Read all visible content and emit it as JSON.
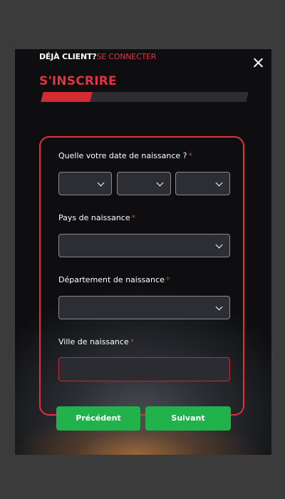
{
  "header": {
    "login_question": "DÉJÀ CLIENT?",
    "login_link": "SE CONNECTER",
    "title": "S'INSCRIRE"
  },
  "progress": {
    "fraction": 0.24
  },
  "form": {
    "birthdate_label": "Quelle votre date de naissance ?",
    "birth_country_label": "Pays de naissance",
    "birth_department_label": "Département de naissance",
    "birth_city_label": "Ville de naissance",
    "required_marker": "*",
    "birth_city_value": ""
  },
  "buttons": {
    "previous": "Précédent",
    "next": "Suivant"
  },
  "colors": {
    "accent_red": "#e0333d",
    "button_green": "#22b24c"
  },
  "icons": {
    "close": "close-icon",
    "select_arrow": "chevron-down-icon"
  }
}
